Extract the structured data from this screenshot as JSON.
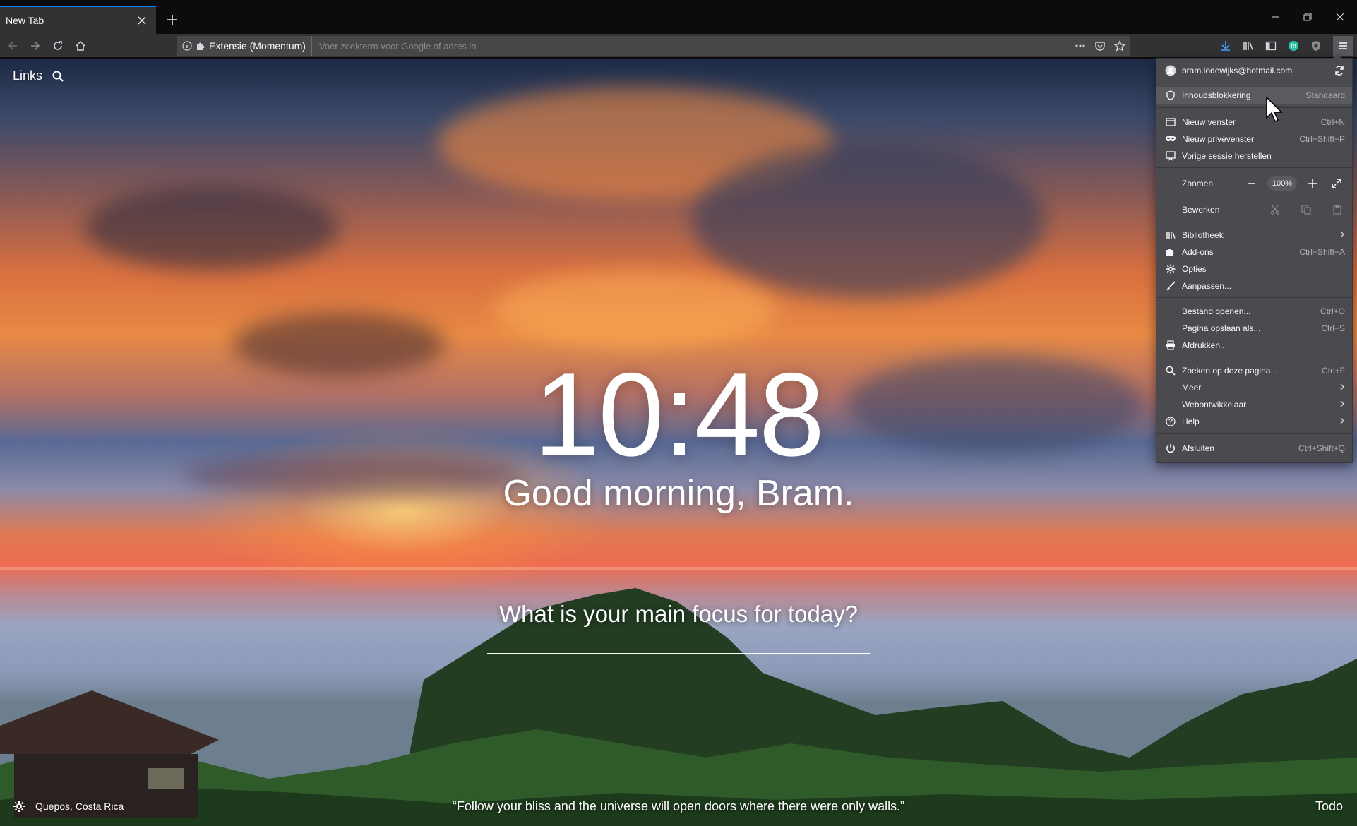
{
  "browser": {
    "tab_title": "New Tab",
    "url_identity_label": "Extensie (Momentum)",
    "url_placeholder": "Voer zoekterm voor Google of adres in"
  },
  "momentum": {
    "links_label": "Links",
    "time": "10:48",
    "greeting": "Good morning, Bram.",
    "focus_question": "What is your main focus for today?",
    "location": "Quepos, Costa Rica",
    "quote": "“Follow your bliss and the universe will open doors where there were only walls.”",
    "todo_label": "Todo"
  },
  "menu": {
    "account_email": "bram.lodewijks@hotmail.com",
    "content_blocking": {
      "label": "Inhoudsblokkering",
      "value": "Standaard"
    },
    "new_window": {
      "label": "Nieuw venster",
      "shortcut": "Ctrl+N"
    },
    "new_private": {
      "label": "Nieuw privévenster",
      "shortcut": "Ctrl+Shift+P"
    },
    "restore_session": {
      "label": "Vorige sessie herstellen"
    },
    "zoom": {
      "label": "Zoomen",
      "value": "100%"
    },
    "edit": {
      "label": "Bewerken"
    },
    "library": {
      "label": "Bibliotheek"
    },
    "addons": {
      "label": "Add-ons",
      "shortcut": "Ctrl+Shift+A"
    },
    "options": {
      "label": "Opties"
    },
    "customize": {
      "label": "Aanpassen..."
    },
    "open_file": {
      "label": "Bestand openen...",
      "shortcut": "Ctrl+O"
    },
    "save_page": {
      "label": "Pagina opslaan als...",
      "shortcut": "Ctrl+S"
    },
    "print": {
      "label": "Afdrukken..."
    },
    "find": {
      "label": "Zoeken op deze pagina...",
      "shortcut": "Ctrl+F"
    },
    "more": {
      "label": "Meer"
    },
    "webdev": {
      "label": "Webontwikkelaar"
    },
    "help": {
      "label": "Help"
    },
    "quit": {
      "label": "Afsluiten",
      "shortcut": "Ctrl+Shift+Q"
    }
  },
  "colors": {
    "accent": "#0a84ff",
    "menu_bg": "#4a4a4f",
    "toolbar_bg": "#323234",
    "download_icon": "#45a1ff",
    "momentum_badge": "#2ec4a6"
  },
  "icons": {
    "back": "arrow-left-icon",
    "forward": "arrow-right-icon",
    "reload": "reload-icon",
    "home": "home-icon",
    "info": "info-icon",
    "extension": "puzzle-icon",
    "page_actions": "ellipsis-icon",
    "pocket": "pocket-icon",
    "bookmark": "star-icon",
    "downloads": "download-icon",
    "library": "library-icon",
    "sidebar": "sidebar-icon",
    "hamburger": "hamburger-icon"
  }
}
